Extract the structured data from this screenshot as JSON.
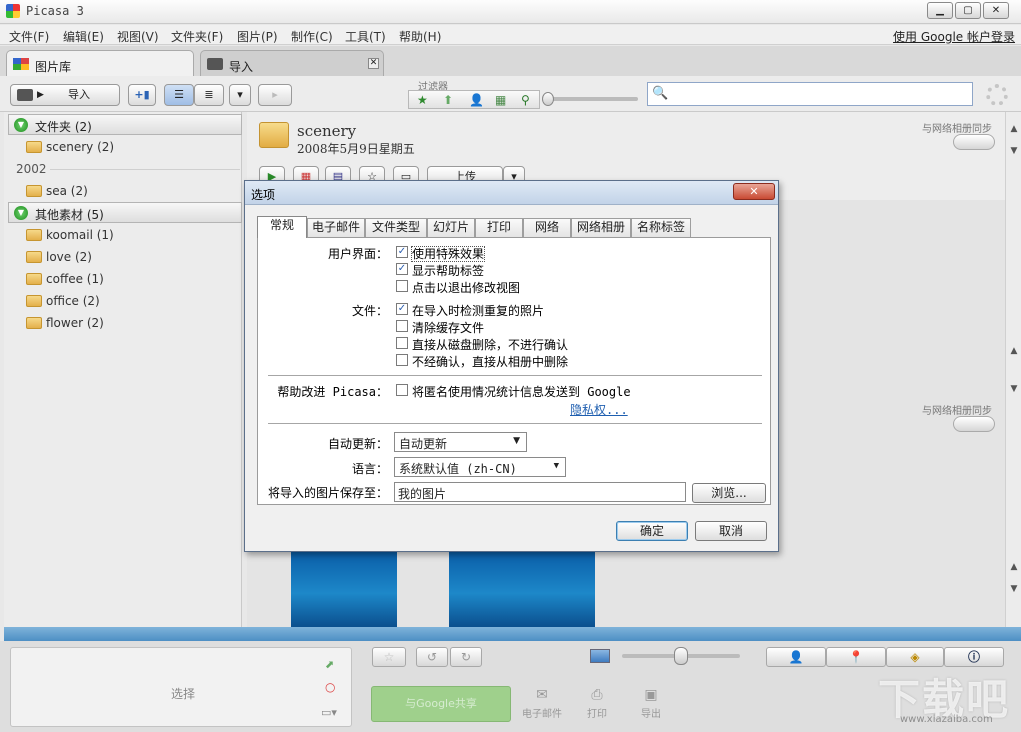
{
  "window": {
    "title": "Picasa 3",
    "controls": [
      "▁",
      "▢",
      "✕"
    ]
  },
  "menu": {
    "items": [
      "文件(F)",
      "编辑(E)",
      "视图(V)",
      "文件夹(F)",
      "图片(P)",
      "制作(C)",
      "工具(T)",
      "帮助(H)"
    ],
    "login": "使用 Google 帐户登录"
  },
  "tabs": [
    {
      "label": "图片库",
      "active": true
    },
    {
      "label": "导入",
      "active": false
    }
  ],
  "toolbar": {
    "import_label": "导入",
    "filters_label": "过滤器",
    "search_placeholder": ""
  },
  "sidebar": {
    "groups": [
      {
        "label": "文件夹 (2)",
        "items": [
          {
            "label": "scenery (2)"
          }
        ],
        "year": "2002",
        "year_items": [
          {
            "label": "sea (2)"
          }
        ]
      },
      {
        "label": "其他素材 (5)",
        "items": [
          {
            "label": "koomail (1)"
          },
          {
            "label": "love (2)"
          },
          {
            "label": "coffee (1)"
          },
          {
            "label": "office (2)"
          },
          {
            "label": "flower (2)"
          }
        ]
      }
    ]
  },
  "album": {
    "name": "scenery",
    "date": "2008年5月9日星期五",
    "sync_label": "与网络相册同步",
    "upload_label": "上传"
  },
  "bottom": {
    "selection_label": "选择",
    "share_label": "与Google共享",
    "actions": [
      {
        "label": "电子邮件",
        "icon": "mail-icon"
      },
      {
        "label": "打印",
        "icon": "printer-icon"
      },
      {
        "label": "导出",
        "icon": "export-icon"
      }
    ]
  },
  "dialog": {
    "title": "选项",
    "close": "✕",
    "tabs": [
      "常规",
      "电子邮件",
      "文件类型",
      "幻灯片",
      "打印",
      "网络",
      "网络相册",
      "名称标签"
    ],
    "active_tab": "常规",
    "ui_label": "用户界面：",
    "ui_options": [
      {
        "label": "使用特殊效果",
        "checked": true
      },
      {
        "label": "显示帮助标签",
        "checked": true
      },
      {
        "label": "点击以退出修改视图",
        "checked": false
      }
    ],
    "files_label": "文件：",
    "file_options": [
      {
        "label": "在导入时检测重复的照片",
        "checked": true
      },
      {
        "label": "清除缓存文件",
        "checked": false
      },
      {
        "label": "直接从磁盘删除，不进行确认",
        "checked": false
      },
      {
        "label": "不经确认，直接从相册中删除",
        "checked": false
      }
    ],
    "improve_label": "帮助改进 Picasa：",
    "improve_option": {
      "label": "将匿名使用情况统计信息发送到 Google",
      "checked": false
    },
    "privacy_link": "隐私权...",
    "update_label": "自动更新：",
    "update_value": "自动更新",
    "language_label": "语言：",
    "language_value": "系统默认值 (zh-CN)",
    "save_label": "将导入的图片保存至：",
    "save_value": "我的图片",
    "browse": "浏览...",
    "ok": "确定",
    "cancel": "取消"
  },
  "watermark": {
    "text": "下载吧",
    "sub": "www.xiazaiba.com"
  }
}
